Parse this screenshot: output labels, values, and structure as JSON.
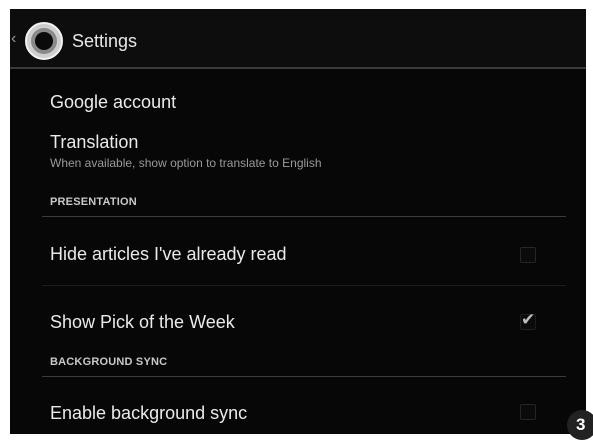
{
  "action_bar": {
    "up_icon": "chevron-left-icon",
    "app_icon": "app-logo",
    "title": "Settings"
  },
  "items": [
    {
      "title": "Google account"
    },
    {
      "title": "Translation",
      "summary": "When available, show option to translate to English"
    }
  ],
  "sections": [
    {
      "header": "PRESENTATION",
      "items": [
        {
          "title": "Hide articles I've already read",
          "checked": false
        },
        {
          "title": "Show Pick of the Week",
          "checked": true
        }
      ]
    },
    {
      "header": "BACKGROUND SYNC",
      "items": [
        {
          "title": "Enable background sync",
          "checked": false
        }
      ]
    }
  ],
  "page_number": "3",
  "colors": {
    "background": "#070707",
    "text": "#eaeaea",
    "subtext": "#9a9a9a",
    "divider": "#3c3c3c"
  }
}
